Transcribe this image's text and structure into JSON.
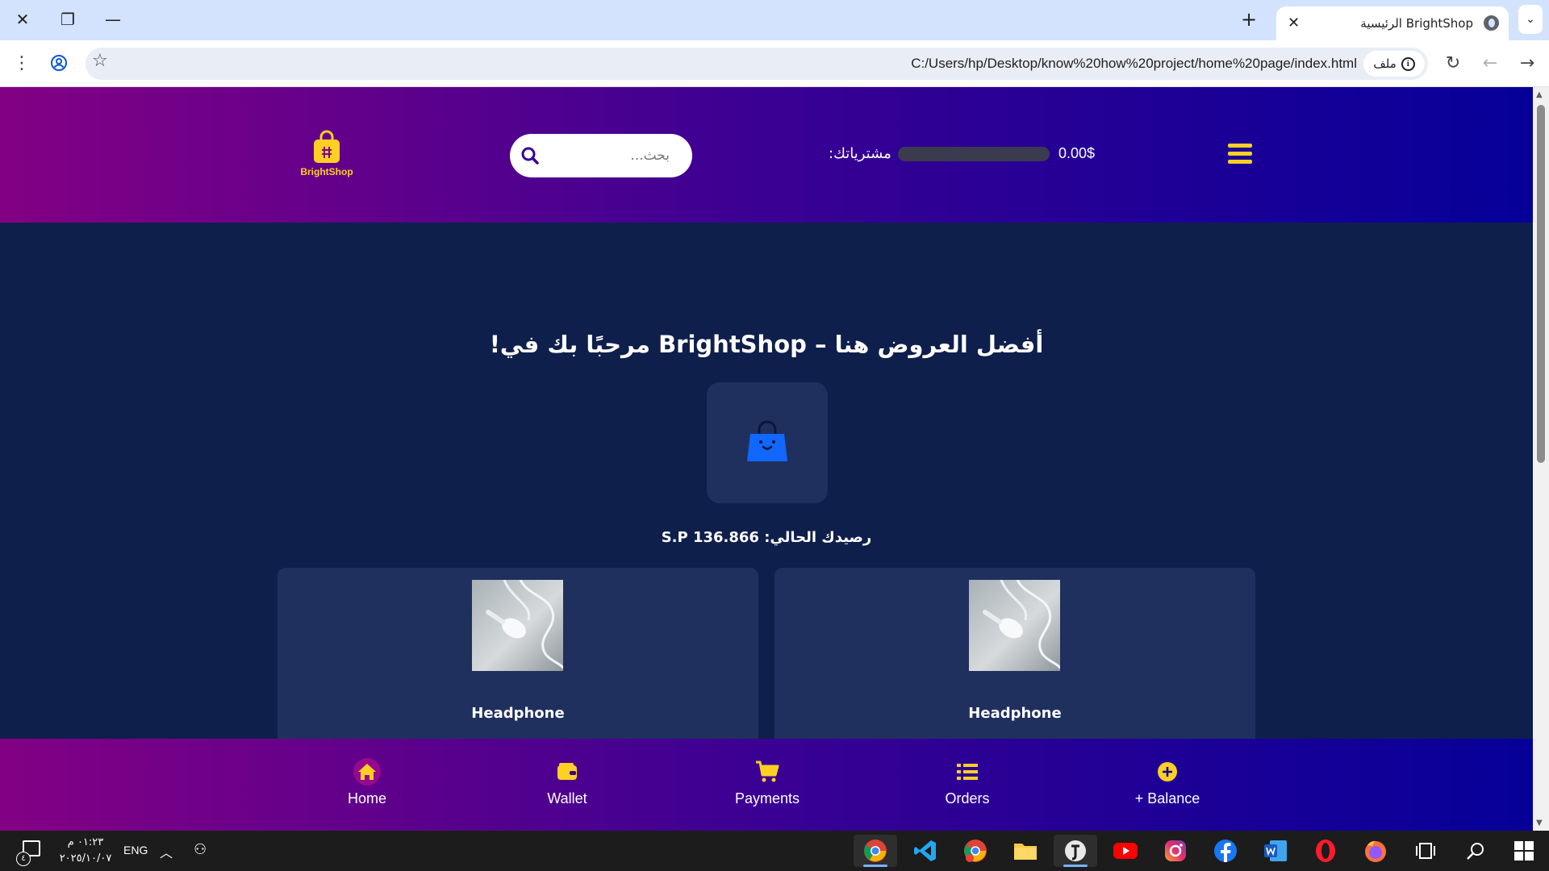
{
  "browser": {
    "tab_title": "BrightShop الرئيسية",
    "url": "C:/Users/hp/Desktop/know%20how%20project/home%20page/index.html",
    "site_chip_label": "ملف"
  },
  "header": {
    "logo_text": "BrightShop",
    "search_placeholder": "بحث...",
    "subscriptions_label": "مشترياتك:",
    "subscriptions_value": "0.00$",
    "subscriptions_progress": 0.0
  },
  "main": {
    "welcome": "أفضل العروض هنا – BrightShop مرحبًا بك في!",
    "balance_text": "رصيدك الحالي: S.P 136.866"
  },
  "products": [
    {
      "name": "Headphone"
    },
    {
      "name": "Headphone"
    }
  ],
  "bottom_nav": [
    {
      "label": "Home",
      "icon": "home-icon"
    },
    {
      "label": "Wallet",
      "icon": "wallet-icon"
    },
    {
      "label": "Payments",
      "icon": "cart-icon"
    },
    {
      "label": "Orders",
      "icon": "list-icon"
    },
    {
      "label": "+ Balance",
      "icon": "plus-circle-icon"
    }
  ],
  "taskbar": {
    "time": "٠١:٢٣ م",
    "date": "٢٠٢٥/١٠/٠٧",
    "language": "ENG",
    "notification_count": "٤"
  },
  "colors": {
    "accent_yellow": "#ffcf24",
    "page_background": "#0f1f4c",
    "card_background": "#1f305e",
    "gradient_start": "#830084",
    "gradient_end": "#050099"
  }
}
